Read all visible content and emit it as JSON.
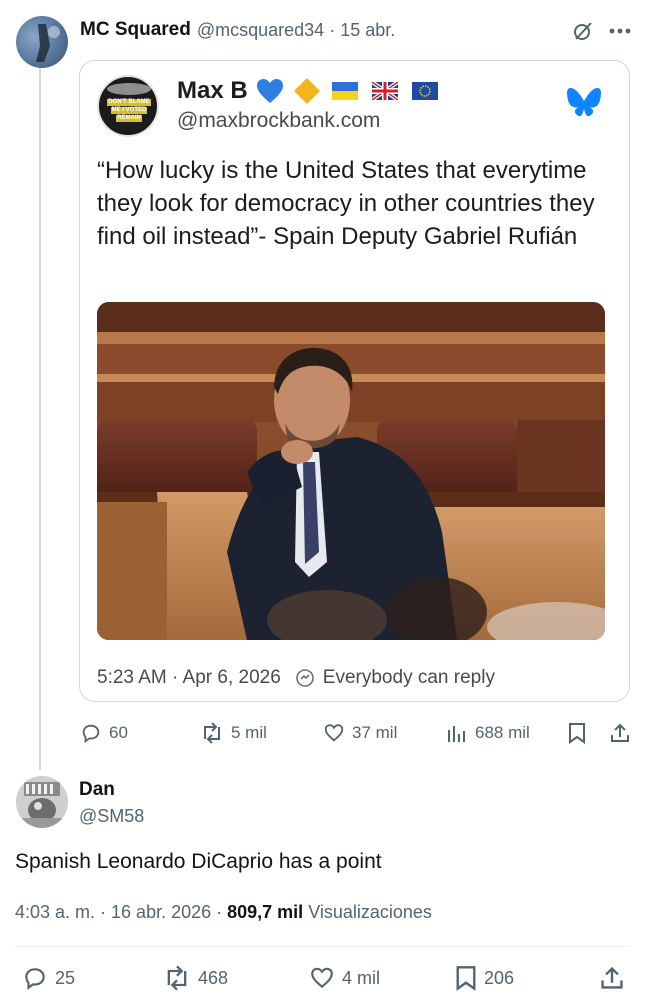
{
  "post": {
    "author_name": "MC Squared",
    "author_handle": "@mcsquared34",
    "separator": "·",
    "date": "15 abr.",
    "more_label": "···"
  },
  "quote": {
    "name": "Max B",
    "handle": "@maxbrockbank.com",
    "avatar_text": [
      "DON'T BLAME",
      "ME I VOTED",
      "REMAIN"
    ],
    "text": "“How lucky is the United States that everytime they look for democracy in other countries they find oil instead”- Spain Deputy Gabriel Rufián",
    "time": "5:23 AM · Apr 6, 2026",
    "reply_setting": "Everybody can reply",
    "brand_color": "#1185fe"
  },
  "post_actions": {
    "replies": "60",
    "reposts": "5 mil",
    "likes": "37 mil",
    "views": "688 mil"
  },
  "reply": {
    "author_name": "Dan",
    "author_handle": "@SM58",
    "text": "Spanish Leonardo DiCaprio has a point",
    "time": "4:03 a. m. · 16 abr. 2026 · ",
    "views_count": "809,7 mil",
    "views_label": "Visualizaciones"
  },
  "reply_actions": {
    "replies": "25",
    "reposts": "468",
    "likes": "4 mil",
    "bookmarks": "206"
  },
  "colors": {
    "text": "#0f1419",
    "muted": "#536471",
    "border": "#cfd9de"
  }
}
